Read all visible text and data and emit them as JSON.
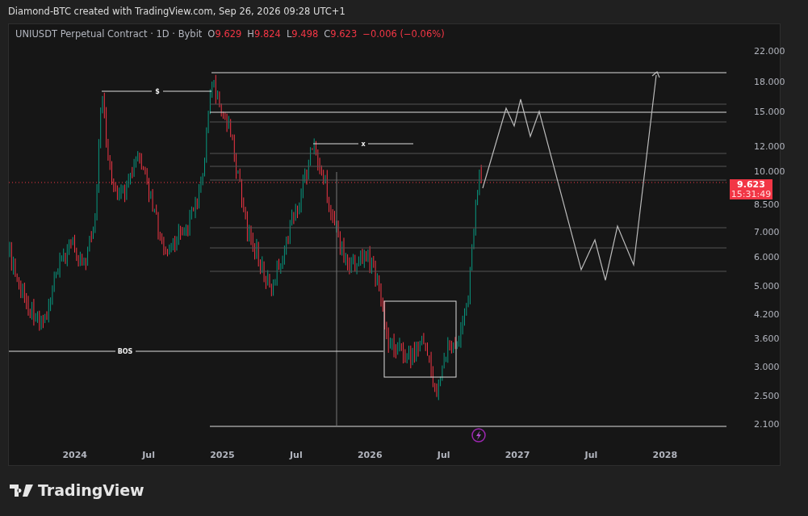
{
  "header": {
    "text": "Diamond-BTC created with TradingView.com, Sep 26, 2026 09:28 UTC+1"
  },
  "legend": {
    "symbol": "UNIUSDT Perpetual Contract · 1D · Bybit",
    "falling": true,
    "ohlc": [
      {
        "label": "O",
        "value": "9.629"
      },
      {
        "label": "H",
        "value": "9.824"
      },
      {
        "label": "L",
        "value": "9.498"
      },
      {
        "label": "C",
        "value": "9.623"
      }
    ],
    "change": "−0.006 (−0.06%)"
  },
  "annotations": [
    {
      "text": "$"
    },
    {
      "text": "x"
    },
    {
      "text": "BOS"
    }
  ],
  "price_axis": {
    "ticks": [
      "22.000",
      "18.000",
      "15.000",
      "12.000",
      "10.000",
      "8.500",
      "7.000",
      "6.000",
      "5.000",
      "4.200",
      "3.600",
      "3.000",
      "2.500",
      "2.100"
    ]
  },
  "price_tag": {
    "price": "9.623",
    "countdown": "15:31:49",
    "falling": true
  },
  "time_axis": {
    "ticks": [
      "2024",
      "Jul",
      "2025",
      "Jul",
      "2026",
      "Jul",
      "2027",
      "Jul",
      "2028"
    ]
  },
  "brand": {
    "name": "TradingView"
  }
}
